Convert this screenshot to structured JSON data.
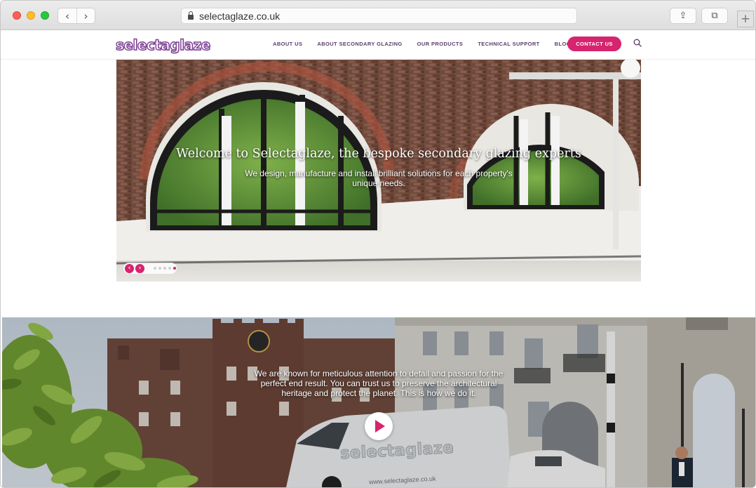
{
  "browser": {
    "url": "selectaglaze.co.uk",
    "back_icon": "‹",
    "forward_icon": "›",
    "share_icon": "⇪",
    "tabs_icon": "⧉",
    "new_tab_icon": "+"
  },
  "header": {
    "logo": "selectaglaze",
    "nav": [
      {
        "label": "ABOUT US"
      },
      {
        "label": "ABOUT SECONDARY GLAZING"
      },
      {
        "label": "OUR PRODUCTS"
      },
      {
        "label": "TECHNICAL SUPPORT"
      },
      {
        "label": "BLOGS & EVENTS"
      }
    ],
    "contact_label": "CONTACT US"
  },
  "hero": {
    "title": "Welcome to Selectaglaze, the bespoke secondary glazing experts",
    "subtitle": "We design, manufacture and install brilliant solutions for each property's unique needs.",
    "prev_icon": "‹",
    "next_icon": "›",
    "slide_count": 5,
    "active_slide": 5
  },
  "video": {
    "text": "We are known for meticulous attention to detail and passion for the perfect end result. You can trust us to preserve the architectural heritage and protect the planet. This is how we do it.",
    "van_brand": "selectaglaze",
    "van_url": "www.selectaglaze.co.uk"
  },
  "colors": {
    "brand_purple": "#7b3f91",
    "nav_text": "#5c3b6e",
    "accent_pink": "#d6246e"
  }
}
